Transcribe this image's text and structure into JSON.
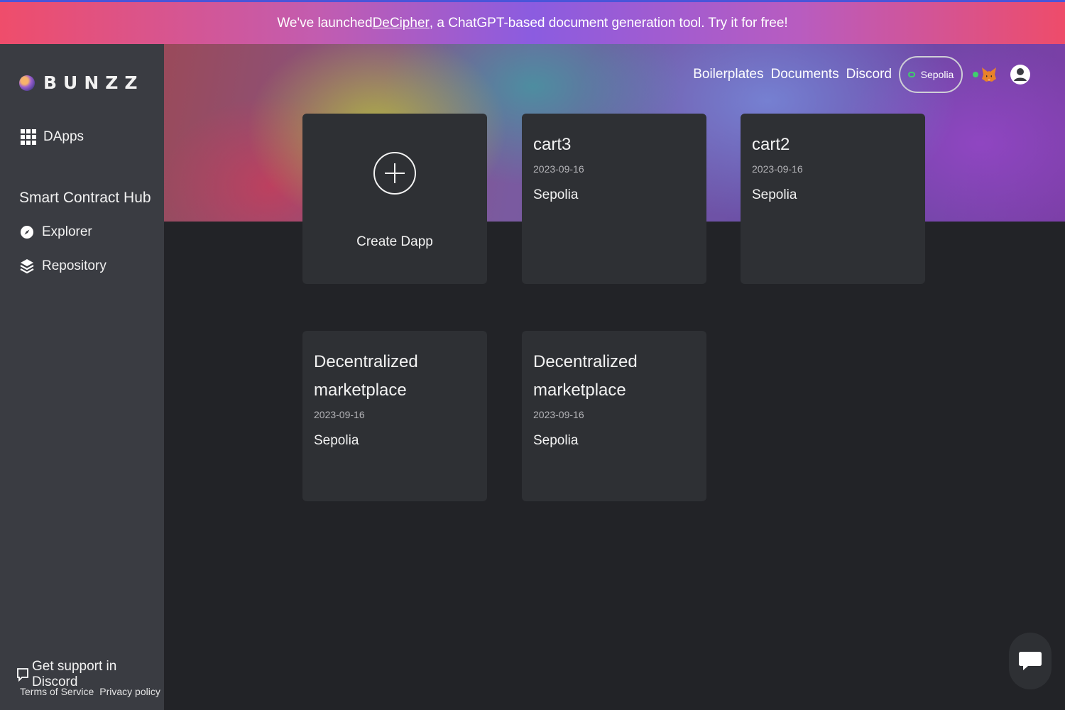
{
  "banner": {
    "text_before": "We've launched ",
    "link_text": "DeCipher",
    "text_after": ", a ChatGPT-based document generation tool. Try it for free!"
  },
  "sidebar": {
    "logo_text": "BUNZZ",
    "dapps_label": "DApps",
    "hub_title": "Smart Contract Hub",
    "explorer_label": "Explorer",
    "repository_label": "Repository",
    "support_label": "Get support in Discord",
    "terms_label": "Terms of Service",
    "privacy_label": "Privacy policy"
  },
  "topnav": {
    "boilerplates": "Boilerplates",
    "documents": "Documents",
    "discord": "Discord",
    "network": "Sepolia"
  },
  "create_card": {
    "label": "Create Dapp"
  },
  "dapps": [
    {
      "title": "cart3",
      "date": "2023-09-16",
      "network": "Sepolia"
    },
    {
      "title": "cart2",
      "date": "2023-09-16",
      "network": "Sepolia"
    },
    {
      "title": "Decentralized marketplace",
      "date": "2023-09-16",
      "network": "Sepolia"
    },
    {
      "title": "Decentralized marketplace",
      "date": "2023-09-16",
      "network": "Sepolia"
    }
  ],
  "colors": {
    "sidebar_bg": "#3a3c42",
    "page_bg": "#222327",
    "card_bg": "#2e3034",
    "network_dot": "#3ecf6b"
  }
}
